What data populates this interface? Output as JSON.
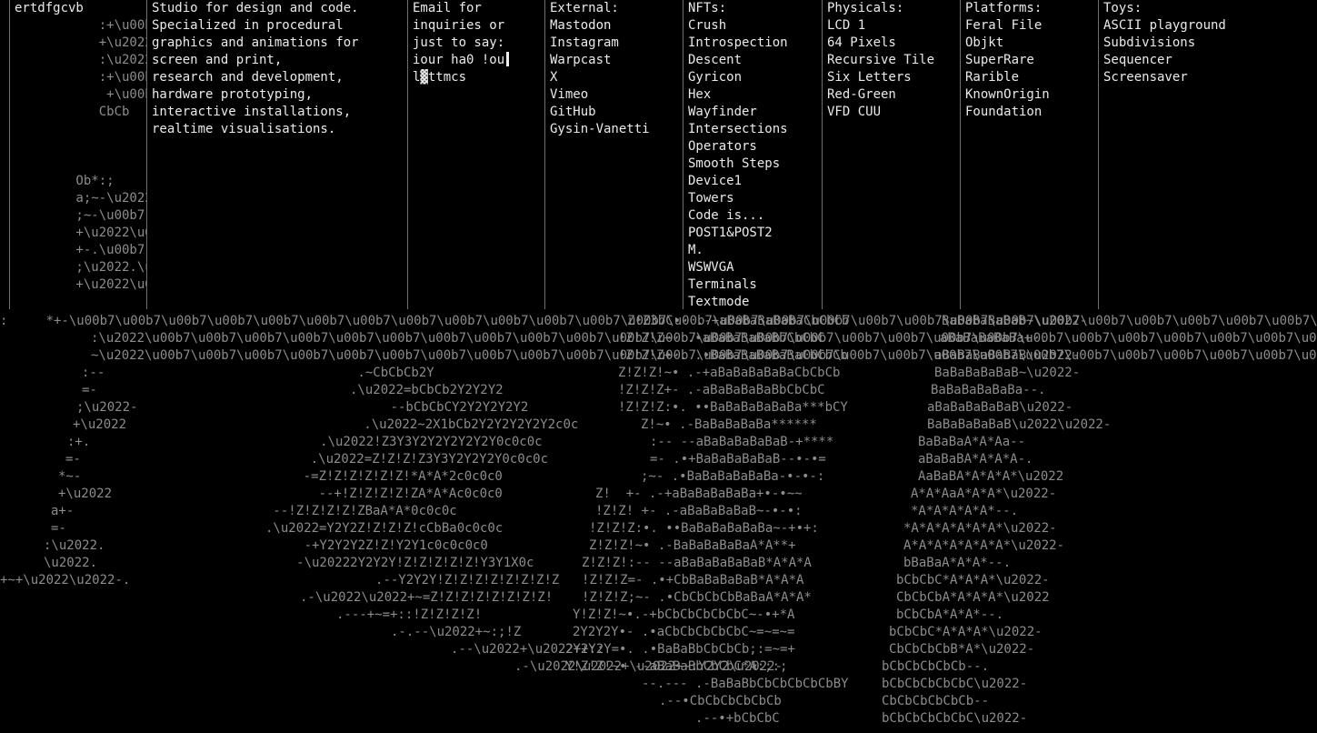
{
  "brand": "ertdfgcvb",
  "about": {
    "lines": [
      "Studio for design and code.",
      "Specialized in procedural",
      "graphics and animations for",
      "screen and print,",
      "research and development,",
      "hardware prototyping,",
      "interactive installations,",
      "realtime visualisations."
    ]
  },
  "contact": {
    "lines": [
      "Email for",
      "inquiries or",
      "just to say:"
    ],
    "input_value": "iour ha0 !ou",
    "input_line2": "l▓ttmcs"
  },
  "external": {
    "title": "External:",
    "items": [
      "Mastodon",
      "Instagram",
      "Warpcast",
      "X",
      "Vimeo",
      "GitHub",
      "Gysin-Vanetti"
    ]
  },
  "nfts": {
    "title": "NFTs:",
    "items": [
      "Crush",
      "Introspection",
      "Descent",
      "Gyricon",
      "Hex",
      "Wayfinder",
      "Intersections",
      "Operators",
      "Smooth Steps",
      "Device1",
      "Towers",
      "Code is...",
      "POST1&POST2",
      "M.",
      "WSWVGA",
      "Terminals",
      "Textmode"
    ]
  },
  "physicals": {
    "title": "Physicals:",
    "items": [
      "LCD 1",
      "64 Pixels",
      "Recursive Tile",
      "Six Letters",
      "Red-Green",
      "VFD CUU"
    ]
  },
  "platforms": {
    "title": "Platforms:",
    "items": [
      "Feral File",
      "Objkt",
      "SuperRare",
      "Rarible",
      "KnownOrigin",
      "Foundation"
    ]
  },
  "toys": {
    "title": "Toys:",
    "items": [
      "ASCII playground",
      "Subdivisions",
      "Sequencer",
      "Screensaver"
    ]
  },
  "colors": {
    "background": "#000000",
    "text": "#eaeaea",
    "ascii": "#8c8c8c",
    "rule": "#6f6f6f"
  },
  "bg_ascii": [
    "Z!Z3bC•- .-+aBaBaBaBaBaCbCbCb",
    "!Z!Z!Z~- .•aBaBaBaBaBbCbCbC",
    "!Z!Z!Z+-. .•BaBaBaBaBaBaCbCbCb",
    "Z!Z!Z!~• .-+aBaBaBaBaBaCbCbCb",
    "!Z!Z!Z+- .-aBaBaBaBaBbCbCbC",
    "!Z!Z!Z:•. ••BaBaBaBaBaBa***bCY",
    "Z!~• .-BaBaBaBaBa******",
    ":-- --aBaBaBaBaBaB-+****",
    "=- .•+BaBaBaBaBaB--•-•=",
    ";~- .•BaBaBaBaBaBa-•-•-:",
    "Z!  +- .-+aBaBaBaBaBa+•-•~~",
    "!Z!Z! +- .-aBaBaBaBaB~-•-•:",
    "!Z!Z!Z:•. ••BaBaBaBaBaBa~-+•+:",
    "Z!Z!Z!~• .-BaBaBaBaBaA*A**+",
    "Z!Z!Z!:-- --aBaBaBaBaBaB*A*A*A",
    "!Z!Z!Z=- .•+CbBaBaBaBaB*A*A*A",
    "!Z!Z!Z;~- .•CbCbCbCbBaBaA*A*A*",
    "Y!Z!Z!~•.-+bCbCbCbCbCbC~-•+*A",
    "2Y2Y2Y•- .•aCbCbCbCbCbC~=~=~=",
    "2Y2Y2Y=•. .•BaBaBbCbCbCb;:=~=+",
    "Y!Z!Z!~• --aBaBaBbCbCbC*A:;:;",
    "--.--- .-BaBaBbCbCbCbCbCbBY",
    ".--•CbCbCbCbCbCb",
    ".--•+bCbCbC"
  ]
}
